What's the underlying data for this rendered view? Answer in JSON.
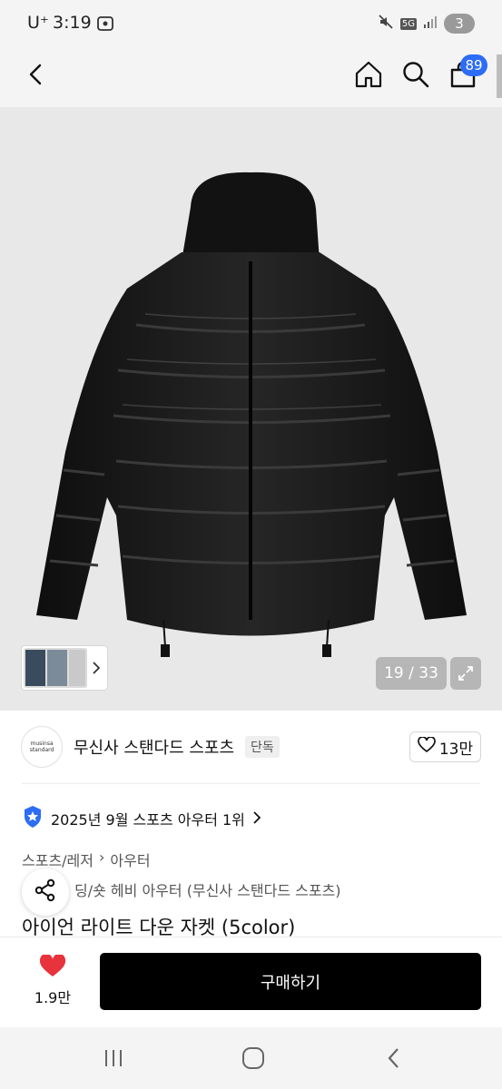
{
  "status_bar": {
    "carrier": "U⁺",
    "time": "3:19",
    "network": "5G",
    "battery": "3"
  },
  "header": {
    "cart_count": "89"
  },
  "gallery": {
    "counter": "19 / 33"
  },
  "brand": {
    "logo_line1": "musinsa",
    "logo_line2": "standard",
    "name": "무신사 스탠다드 스포츠",
    "exclusive_label": "단독",
    "likes": "13만"
  },
  "ranking": {
    "text": "2025년 9월 스포츠 아우터 1위"
  },
  "breadcrumb": [
    "스포츠/레저",
    "아우터"
  ],
  "product": {
    "subtitle": "딩/숏 헤비 아우터 (무신사 스탠다드 스포츠)",
    "title": "아이언 라이트 다운 자켓 (5color)"
  },
  "purchase_bar": {
    "wish_count": "1.9만",
    "buy_label": "구매하기"
  },
  "colors": {
    "accent_blue": "#2c6cf6",
    "heart_red": "#e8323c",
    "buy_button": "#000000"
  },
  "icons": [
    "back-arrow-icon",
    "home-icon",
    "search-icon",
    "cart-icon",
    "chevron-right-icon",
    "expand-icon",
    "heart-outline-icon",
    "ranking-badge-icon",
    "share-icon",
    "heart-filled-icon",
    "recent-apps-icon",
    "home-circle-icon",
    "system-back-icon"
  ]
}
